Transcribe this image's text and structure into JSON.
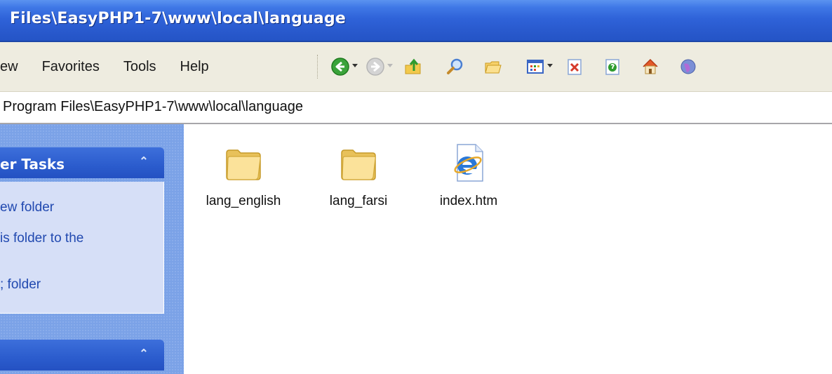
{
  "window": {
    "title": "Files\\EasyPHP1-7\\www\\local\\language"
  },
  "menu": {
    "items": [
      "ew",
      "Favorites",
      "Tools",
      "Help"
    ]
  },
  "toolbar": {
    "buttons": [
      {
        "icon": "back-arrow-icon",
        "enabled": true,
        "has_dropdown": true
      },
      {
        "icon": "forward-arrow-icon",
        "enabled": false,
        "has_dropdown": true
      },
      {
        "icon": "folder-up-icon",
        "enabled": true
      },
      {
        "icon": "search-icon",
        "enabled": true
      },
      {
        "icon": "folders-icon",
        "enabled": true
      },
      {
        "icon": "views-icon",
        "enabled": true,
        "has_dropdown": true
      },
      {
        "icon": "delete-icon",
        "enabled": true
      },
      {
        "icon": "properties-icon",
        "enabled": true
      },
      {
        "icon": "home-icon",
        "enabled": true
      },
      {
        "icon": "globe-icon",
        "enabled": true
      }
    ]
  },
  "address": {
    "path": "Program Files\\EasyPHP1-7\\www\\local\\language"
  },
  "taskpane": {
    "panel1": {
      "title": "er Tasks",
      "tasks": [
        "ew folder",
        "is folder to the",
        "; folder"
      ]
    },
    "panel2": {
      "title": ""
    }
  },
  "files": [
    {
      "name": "lang_english",
      "type": "folder",
      "icon": "folder-icon"
    },
    {
      "name": "lang_farsi",
      "type": "folder",
      "icon": "folder-icon"
    },
    {
      "name": "index.htm",
      "type": "html",
      "icon": "ie-document-icon"
    }
  ],
  "colors": {
    "titlebar": "#2a5bcf",
    "taskpane": "#7ba2e7",
    "task_link": "#2149b0",
    "toolbar_bg": "#eeece0"
  }
}
